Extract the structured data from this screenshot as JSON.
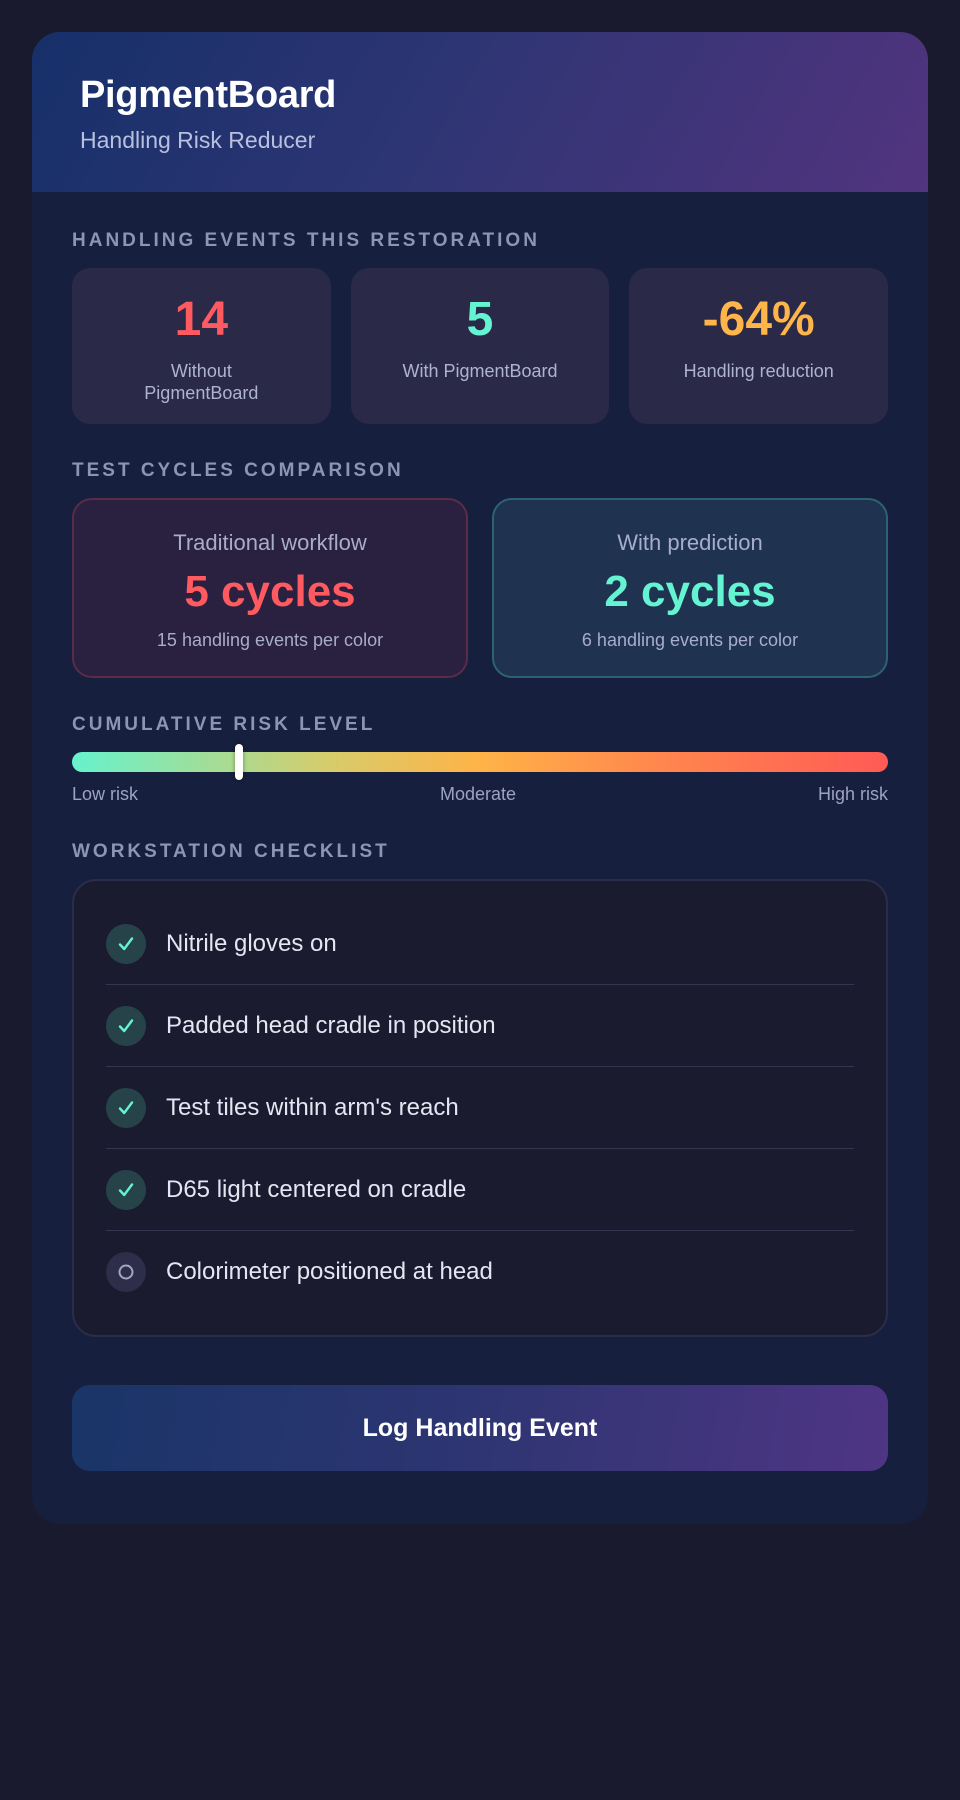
{
  "header": {
    "title": "PigmentBoard",
    "subtitle": "Handling Risk Reducer"
  },
  "handling_events": {
    "section_label": "Handling events this restoration",
    "stats": [
      {
        "value": "14",
        "caption": "Without PigmentBoard",
        "color": "#ff5a5f"
      },
      {
        "value": "5",
        "caption": "With PigmentBoard",
        "color": "#64f4d2"
      },
      {
        "value": "-64%",
        "caption": "Handling reduction",
        "color": "#ffb54a"
      }
    ]
  },
  "test_cycles": {
    "section_label": "Test cycles comparison",
    "traditional": {
      "label": "Traditional workflow",
      "value": "5 cycles",
      "description": "15 handling events per color",
      "color": "#ff5a5f"
    },
    "prediction": {
      "label": "With prediction",
      "value": "2 cycles",
      "description": "6 handling events per color",
      "color": "#64f4d2"
    }
  },
  "risk": {
    "section_label": "Cumulative risk level",
    "level_fraction": 0.205,
    "low_label": "Low risk",
    "mid_label": "Moderate",
    "high_label": "High risk"
  },
  "checklist": {
    "section_label": "Workstation checklist",
    "items": [
      {
        "label": "Nitrile gloves on",
        "checked": true
      },
      {
        "label": "Padded head cradle in position",
        "checked": true
      },
      {
        "label": "Test tiles within arm's reach",
        "checked": true
      },
      {
        "label": "D65 light centered on cradle",
        "checked": true
      },
      {
        "label": "Colorimeter positioned at head",
        "checked": false
      }
    ]
  },
  "cta": {
    "label": "Log Handling Event"
  },
  "colors": {
    "check_accent": "#64f4d2",
    "unchecked_ring": "#a3a6c4"
  }
}
